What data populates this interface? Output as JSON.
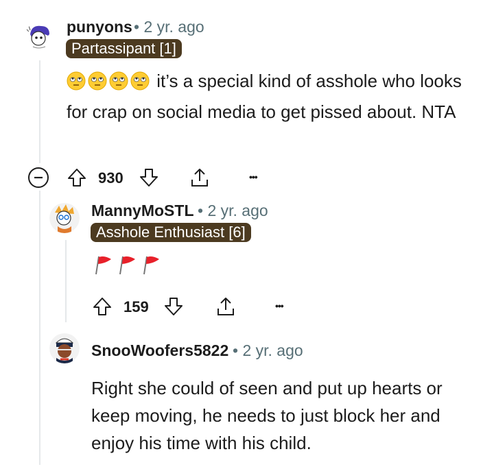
{
  "comments": [
    {
      "username": "punyons",
      "time": "2 yr. ago",
      "flair": "Partassipant [1]",
      "emoji_count": 4,
      "emoji_icon": "face-with-rolling-eyes",
      "text": "it’s a special kind of asshole who looks for crap on social media to get pissed about. NTA",
      "votes": "930"
    },
    {
      "username": "MannyMoSTL",
      "time": "2 yr. ago",
      "flair": "Asshole Enthusiast [6]",
      "emoji_icon": "red-flag",
      "emoji_count": 3,
      "votes": "159"
    },
    {
      "username": "SnooWoofers5822",
      "time": "2 yr. ago",
      "text": "Right she could of seen and put up hearts or keep moving, he needs to just block her and enjoy his time with his child."
    }
  ],
  "separator": "•",
  "more_label": "•••",
  "colors": {
    "flair_bg": "#4c3a20",
    "meta": "#576f76",
    "line": "#e5e8ea"
  }
}
